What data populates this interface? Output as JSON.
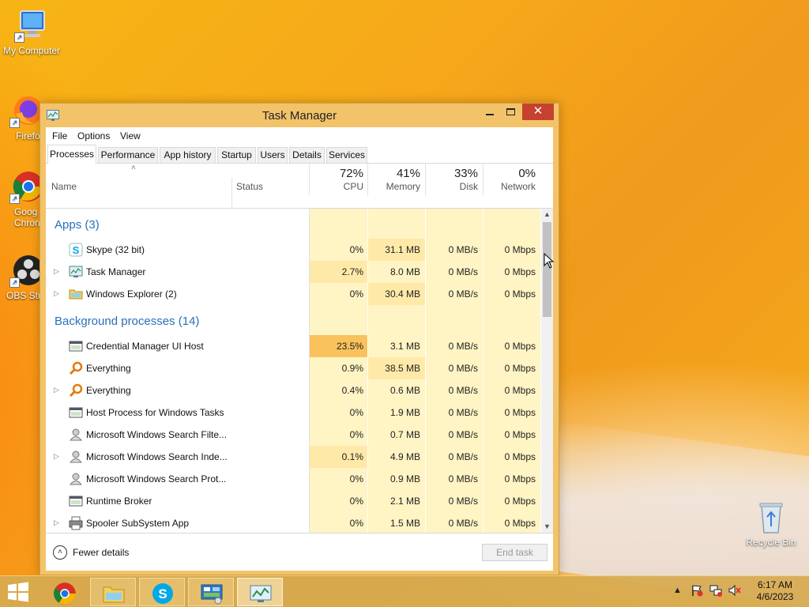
{
  "desktop": {
    "icons": [
      {
        "label": "My Computer"
      },
      {
        "label": "Firefo"
      },
      {
        "label": "Goog Chron"
      },
      {
        "label": "OBS Stu"
      },
      {
        "label": "Recycle Bin"
      }
    ]
  },
  "window": {
    "title": "Task Manager",
    "close_glyph": "✕"
  },
  "menu": [
    "File",
    "Options",
    "View"
  ],
  "tabs": [
    "Processes",
    "Performance",
    "App history",
    "Startup",
    "Users",
    "Details",
    "Services"
  ],
  "active_tab": "Processes",
  "columns": {
    "name": "Name",
    "status": "Status",
    "cpu": {
      "pct": "72%",
      "label": "CPU"
    },
    "memory": {
      "pct": "41%",
      "label": "Memory"
    },
    "disk": {
      "pct": "33%",
      "label": "Disk"
    },
    "network": {
      "pct": "0%",
      "label": "Network"
    }
  },
  "groups": {
    "apps": {
      "title": "Apps (3)",
      "rows": [
        {
          "name": "Skype (32 bit)",
          "icon": "skype-icon",
          "cpu": "0%",
          "memory": "31.1 MB",
          "disk": "0 MB/s",
          "network": "0 Mbps",
          "expandable": false
        },
        {
          "name": "Task Manager",
          "icon": "task-manager-icon",
          "cpu": "2.7%",
          "memory": "8.0 MB",
          "disk": "0 MB/s",
          "network": "0 Mbps",
          "expandable": true
        },
        {
          "name": "Windows Explorer (2)",
          "icon": "explorer-icon",
          "cpu": "0%",
          "memory": "30.4 MB",
          "disk": "0 MB/s",
          "network": "0 Mbps",
          "expandable": true
        }
      ]
    },
    "background": {
      "title": "Background processes (14)",
      "rows": [
        {
          "name": "Credential Manager UI Host",
          "icon": "window-app-icon",
          "cpu": "23.5%",
          "memory": "3.1 MB",
          "disk": "0 MB/s",
          "network": "0 Mbps",
          "expandable": false
        },
        {
          "name": "Everything",
          "icon": "magnifier-icon",
          "cpu": "0.9%",
          "memory": "38.5 MB",
          "disk": "0 MB/s",
          "network": "0 Mbps",
          "expandable": false
        },
        {
          "name": "Everything",
          "icon": "magnifier-icon",
          "cpu": "0.4%",
          "memory": "0.6 MB",
          "disk": "0 MB/s",
          "network": "0 Mbps",
          "expandable": true
        },
        {
          "name": "Host Process for Windows Tasks",
          "icon": "window-app-icon",
          "cpu": "0%",
          "memory": "1.9 MB",
          "disk": "0 MB/s",
          "network": "0 Mbps",
          "expandable": false
        },
        {
          "name": "Microsoft Windows Search Filte...",
          "icon": "user-service-icon",
          "cpu": "0%",
          "memory": "0.7 MB",
          "disk": "0 MB/s",
          "network": "0 Mbps",
          "expandable": false
        },
        {
          "name": "Microsoft Windows Search Inde...",
          "icon": "user-service-icon",
          "cpu": "0.1%",
          "memory": "4.9 MB",
          "disk": "0 MB/s",
          "network": "0 Mbps",
          "expandable": true
        },
        {
          "name": "Microsoft Windows Search Prot...",
          "icon": "user-service-icon",
          "cpu": "0%",
          "memory": "0.9 MB",
          "disk": "0 MB/s",
          "network": "0 Mbps",
          "expandable": false
        },
        {
          "name": "Runtime Broker",
          "icon": "window-app-icon",
          "cpu": "0%",
          "memory": "2.1 MB",
          "disk": "0 MB/s",
          "network": "0 Mbps",
          "expandable": false
        },
        {
          "name": "Spooler SubSystem App",
          "icon": "printer-icon",
          "cpu": "0%",
          "memory": "1.5 MB",
          "disk": "0 MB/s",
          "network": "0 Mbps",
          "expandable": true
        }
      ]
    }
  },
  "footer": {
    "fewer_details": "Fewer details",
    "end_task": "End task"
  },
  "taskbar": {
    "clock_time": "6:17 AM",
    "clock_date": "4/6/2023"
  },
  "colors": {
    "accent_blue": "#2a6fb8",
    "cpu_hot": "#f9c25c",
    "cell_light": "#fff4c4",
    "cell_med": "#ffe9a8",
    "close_red": "#c7412f"
  }
}
